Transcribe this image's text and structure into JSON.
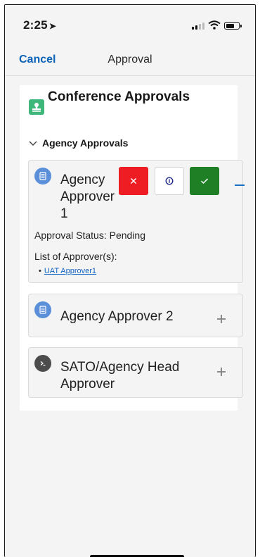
{
  "status_bar": {
    "time": "2:25",
    "location_glyph": "➤"
  },
  "nav": {
    "cancel_label": "Cancel",
    "title": "Approval"
  },
  "card": {
    "title": "Conference Approvals",
    "section_label": "Agency Approvals"
  },
  "approvers": [
    {
      "name": "Agency Approver 1",
      "expanded": true,
      "status_label": "Approval Status:",
      "status_value": "Pending",
      "list_label": "List of Approver(s):",
      "list_items": [
        "UAT Approver1"
      ],
      "actions": {
        "reject_glyph": "×",
        "info_glyph": "ⓘ",
        "approve_glyph": "✓"
      }
    },
    {
      "name": "Agency Approver 2",
      "expanded": false
    },
    {
      "name": "SATO/Agency Head Approver",
      "expanded": false
    }
  ],
  "colors": {
    "accent_link": "#0b63b8",
    "reject": "#ee1d24",
    "approve": "#1f7f25",
    "header_icon": "#3fb77a",
    "avatar_blue": "#5b8fd9",
    "avatar_dark": "#4c4c4c"
  }
}
